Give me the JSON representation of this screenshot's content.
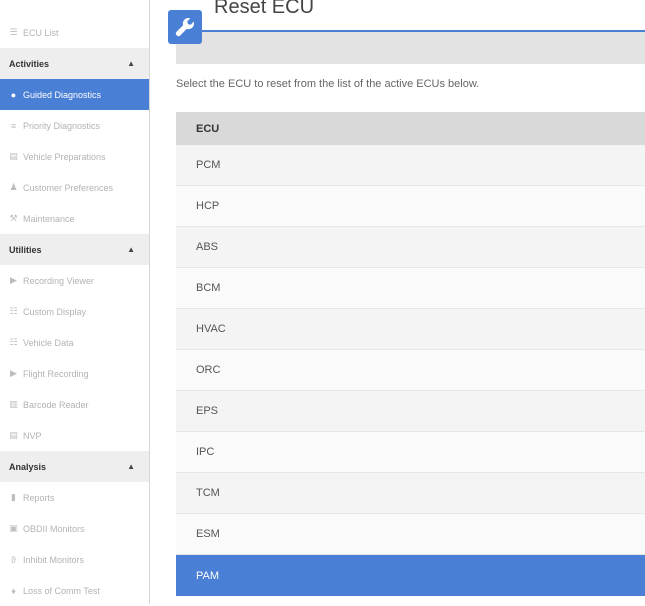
{
  "sidebar": {
    "top_item": "ECU List",
    "sections": [
      {
        "title": "Activities",
        "items": [
          "Guided Diagnostics",
          "Priority Diagnostics",
          "Vehicle Preparations",
          "Customer Preferences",
          "Maintenance"
        ]
      },
      {
        "title": "Utilities",
        "items": [
          "Recording Viewer",
          "Custom Display",
          "Vehicle Data",
          "Flight Recording",
          "Barcode Reader",
          "NVP"
        ]
      },
      {
        "title": "Analysis",
        "items": [
          "Reports",
          "OBDII Monitors",
          "Inhibit Monitors",
          "Loss of Comm Test"
        ]
      }
    ],
    "active_item": "Guided Diagnostics"
  },
  "header": {
    "title": "Reset ECU",
    "icon": "wrench-icon"
  },
  "instruction": "Select the ECU to reset from the list of the active ECUs below.",
  "table": {
    "column_header": "ECU",
    "rows": [
      "PCM",
      "HCP",
      "ABS",
      "BCM",
      "HVAC",
      "ORC",
      "EPS",
      "IPC",
      "TCM",
      "ESM",
      "PAM"
    ],
    "selected": "PAM"
  },
  "colors": {
    "accent": "#4a7fd6",
    "section_bg": "#eeeeee",
    "header_bar": "#e3e3e3",
    "table_header": "#d9d9d9"
  }
}
